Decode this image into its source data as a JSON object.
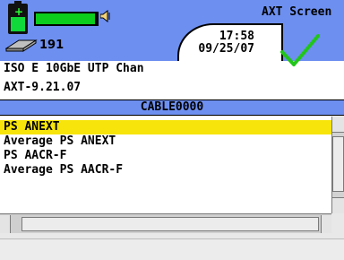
{
  "header": {
    "title": "AXT Screen",
    "count": "191",
    "time": "17:58",
    "date": "09/25/07"
  },
  "info": {
    "line1": "ISO E 10GbE UTP Chan",
    "line2": "AXT-9.21.07"
  },
  "list": {
    "title": "CABLE0000",
    "items": [
      "PS ANEXT",
      "Average PS ANEXT",
      "PS AACR-F",
      "Average PS AACR-F"
    ],
    "selected_index": 0
  },
  "status_text": "",
  "colors": {
    "header_bg": "#6d8ff0",
    "selection": "#f6e40a",
    "battery_green": "#0ccc1c",
    "check_green": "#22c51a"
  },
  "icons": {
    "battery": "battery-icon",
    "signal": "level-bar-icon",
    "speaker": "speaker-icon",
    "cable": "cable-icon",
    "result": "pass-check-icon"
  }
}
